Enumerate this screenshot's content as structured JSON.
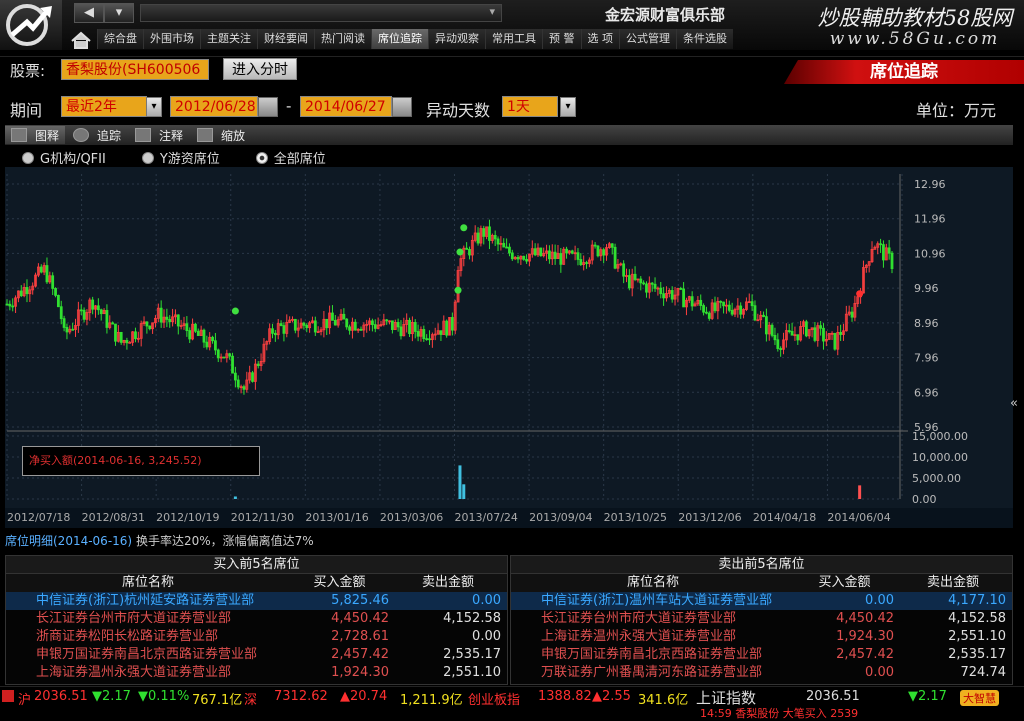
{
  "nav": {
    "back": "◀",
    "dropdown": "▾"
  },
  "broker": "金宏源财富俱乐部",
  "ad": {
    "title": "炒股輔助教材58股网",
    "url": "www.58Gu.com"
  },
  "tabs": [
    "综合盘",
    "外围市场",
    "主题关注",
    "财经要闻",
    "热门阅读",
    "席位追踪",
    "异动观察",
    "常用工具",
    "预 警",
    "选 项",
    "公式管理",
    "条件选股"
  ],
  "active_tab": 5,
  "stock": {
    "label": "股票:",
    "value": "香梨股份(SH600506",
    "button": "进入分时"
  },
  "page_title": "席位追踪",
  "period": {
    "label": "期间",
    "range": "最近2年",
    "start": "2012/06/28",
    "dash": "-",
    "end": "2014/06/27",
    "days_label": "异动天数",
    "days": "1天",
    "unit": "单位：万元"
  },
  "toolbar": [
    {
      "label": "图释"
    },
    {
      "label": "追踪"
    },
    {
      "label": "注释"
    },
    {
      "label": "缩放"
    }
  ],
  "radios": [
    {
      "label": "G机构/QFII",
      "on": false
    },
    {
      "label": "Y游资席位",
      "on": false
    },
    {
      "label": "全部席位",
      "on": true
    }
  ],
  "chart_data": {
    "type": "candlestick",
    "price_ticks": [
      "12.96",
      "11.96",
      "10.96",
      "9.96",
      "8.96",
      "7.96",
      "6.96",
      "5.96"
    ],
    "price_range": [
      5.96,
      12.96
    ],
    "volume_ticks": [
      "15,000.00",
      "10,000.00",
      "5,000.00",
      "0.00"
    ],
    "volume_range": [
      0,
      15000
    ],
    "x_ticks": [
      "2012/07/18",
      "2012/08/31",
      "2012/10/19",
      "2012/11/30",
      "2013/01/16",
      "2013/03/06",
      "2013/07/24",
      "2013/09/04",
      "2013/10/25",
      "2013/12/06",
      "2014/04/18",
      "2014/06/04"
    ],
    "price_anchors": [
      {
        "d": 0,
        "p": 9.5
      },
      {
        "d": 20,
        "p": 10.5
      },
      {
        "d": 28,
        "p": 9.3
      },
      {
        "d": 30,
        "p": 8.6
      },
      {
        "d": 45,
        "p": 9.6
      },
      {
        "d": 60,
        "p": 8.4
      },
      {
        "d": 80,
        "p": 9.2
      },
      {
        "d": 100,
        "p": 8.6
      },
      {
        "d": 115,
        "p": 8.0
      },
      {
        "d": 125,
        "p": 7.0
      },
      {
        "d": 140,
        "p": 8.8
      },
      {
        "d": 170,
        "p": 9.0
      },
      {
        "d": 200,
        "p": 8.9
      },
      {
        "d": 220,
        "p": 8.7
      },
      {
        "d": 235,
        "p": 8.9
      },
      {
        "d": 236,
        "p": 10.6
      },
      {
        "d": 250,
        "p": 11.6
      },
      {
        "d": 262,
        "p": 11.0
      },
      {
        "d": 300,
        "p": 10.8
      },
      {
        "d": 315,
        "p": 11.2
      },
      {
        "d": 325,
        "p": 10.2
      },
      {
        "d": 350,
        "p": 9.8
      },
      {
        "d": 370,
        "p": 9.3
      },
      {
        "d": 390,
        "p": 9.5
      },
      {
        "d": 405,
        "p": 8.4
      },
      {
        "d": 420,
        "p": 8.8
      },
      {
        "d": 435,
        "p": 8.4
      },
      {
        "d": 445,
        "p": 9.4
      },
      {
        "d": 455,
        "p": 11.3
      },
      {
        "d": 465,
        "p": 10.7
      }
    ],
    "signals": [
      {
        "d": 120,
        "p": 9.3,
        "color": "#40e040"
      },
      {
        "d": 237,
        "p": 9.9,
        "color": "#40e040"
      },
      {
        "d": 238,
        "p": 11.0,
        "color": "#40e040"
      },
      {
        "d": 240,
        "p": 11.7,
        "color": "#40e040"
      },
      {
        "d": 448,
        "p": 9.8,
        "color": "#ff3030"
      }
    ],
    "volume_bars": [
      {
        "d": 120,
        "v": 600,
        "color": "#40c0e0"
      },
      {
        "d": 238,
        "v": 8000,
        "color": "#40c0e0"
      },
      {
        "d": 240,
        "v": 3500,
        "color": "#40c0e0"
      },
      {
        "d": 448,
        "v": 3245.52,
        "color": "#ff5050"
      }
    ],
    "legend": "净买入额(2014-06-16, 3,245.52)"
  },
  "detail": {
    "title": "席位明细(2014-06-16)",
    "info": "换手率达20%，涨幅偏离值达7%"
  },
  "buy_table": {
    "title": "买入前5名席位",
    "headers": [
      "席位名称",
      "买入金额",
      "卖出金额"
    ],
    "rows": [
      [
        "中信证券(浙江)杭州延安路证券营业部",
        "5,825.46",
        "0.00"
      ],
      [
        "长江证券台州市府大道证券营业部",
        "4,450.42",
        "4,152.58"
      ],
      [
        "浙商证券松阳长松路证券营业部",
        "2,728.61",
        "0.00"
      ],
      [
        "申银万国证券南昌北京西路证券营业部",
        "2,457.42",
        "2,535.17"
      ],
      [
        "上海证券温州永强大道证券营业部",
        "1,924.30",
        "2,551.10"
      ]
    ]
  },
  "sell_table": {
    "title": "卖出前5名席位",
    "headers": [
      "席位名称",
      "买入金额",
      "卖出金额"
    ],
    "rows": [
      [
        "中信证券(浙江)温州车站大道证券营业部",
        "0.00",
        "4,177.10"
      ],
      [
        "长江证券台州市府大道证券营业部",
        "4,450.42",
        "4,152.58"
      ],
      [
        "上海证券温州永强大道证券营业部",
        "1,924.30",
        "2,551.10"
      ],
      [
        "申银万国证券南昌北京西路证券营业部",
        "2,457.42",
        "2,535.17"
      ],
      [
        "万联证券广州番禺清河东路证券营业部",
        "0.00",
        "724.74"
      ]
    ]
  },
  "status": {
    "sh": "沪",
    "sh_val": "2036.51",
    "sh_chg": "▼2.17",
    "sh_pct": "▼0.11%",
    "sh_amt": "767.1亿",
    "sz": "深",
    "sz_val": "7312.62",
    "sz_chg": "▲20.74",
    "sz_amt": "1,211.9亿",
    "cy": "创业板指",
    "cy_val": "1388.82",
    "cy_chg": "▲2.55",
    "cy_amt": "341.6亿",
    "idx_name": "上证指数",
    "idx_val": "2036.51",
    "idx_chg": "▼2.17",
    "ticker": "14:59 香梨股份 大笔买入 2539",
    "brand": "大智慧"
  },
  "colors": {
    "up": "#ff4040",
    "down": "#30e030",
    "accent": "#d01010"
  }
}
